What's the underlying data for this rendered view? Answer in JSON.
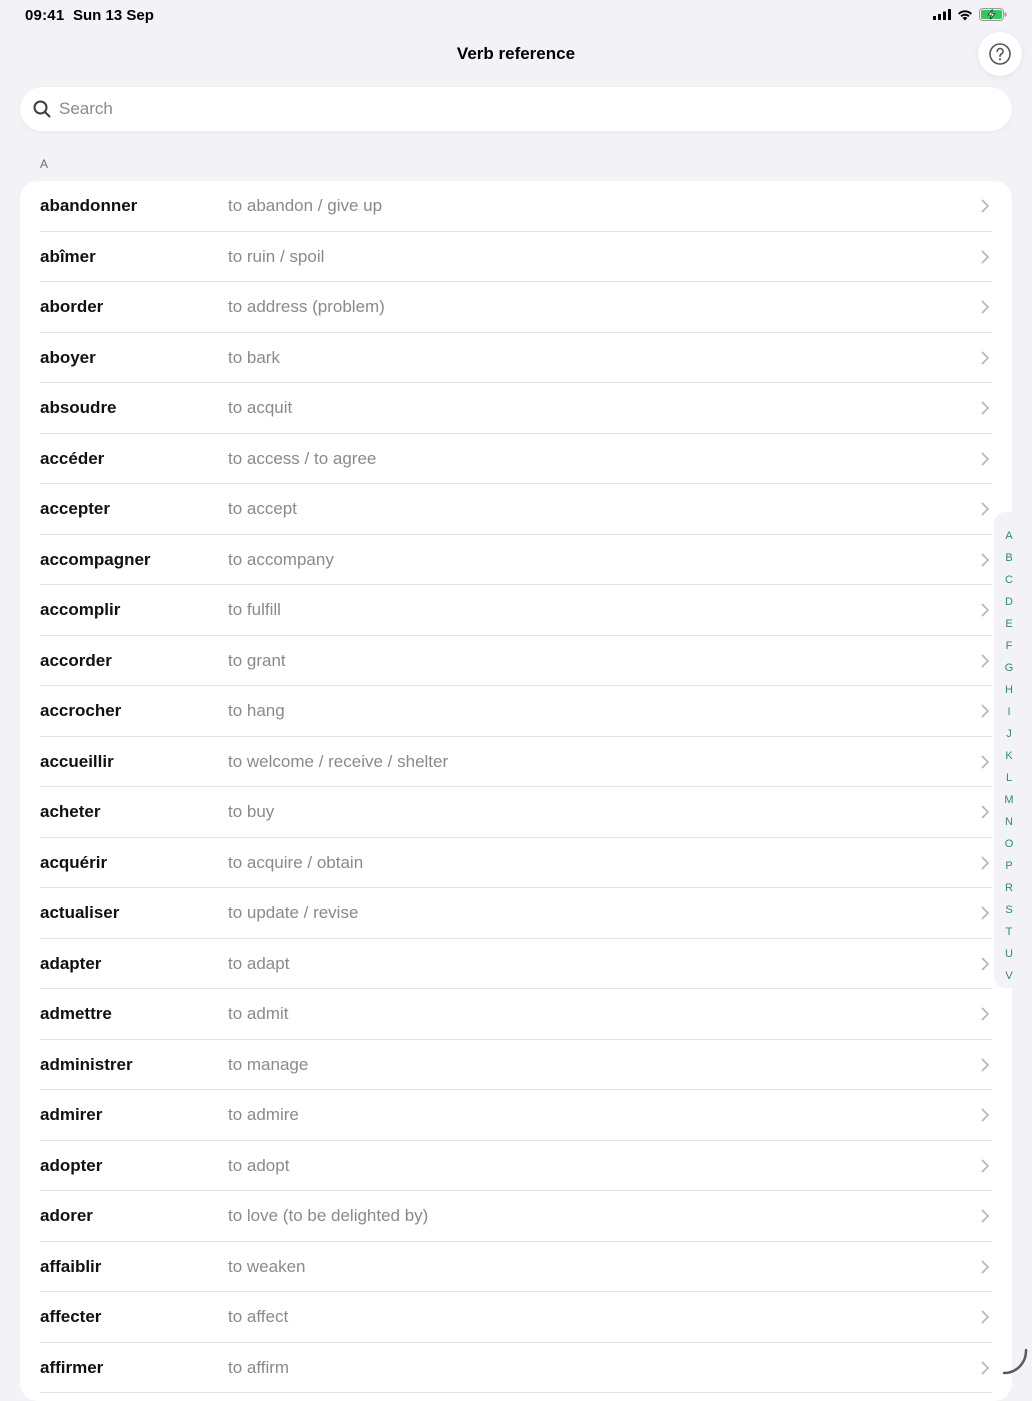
{
  "status": {
    "time": "09:41",
    "date": "Sun 13 Sep",
    "icons": [
      "cellular-signal-icon",
      "wifi-icon",
      "battery-charging-icon"
    ]
  },
  "nav": {
    "title": "Verb reference",
    "help_icon": "question-circle-icon"
  },
  "search": {
    "placeholder": "Search"
  },
  "section": {
    "header": "A"
  },
  "verbs": [
    {
      "verb": "abandonner",
      "meaning": "to abandon / give up"
    },
    {
      "verb": "abîmer",
      "meaning": "to ruin / spoil"
    },
    {
      "verb": "aborder",
      "meaning": "to address (problem)"
    },
    {
      "verb": "aboyer",
      "meaning": "to bark"
    },
    {
      "verb": "absoudre",
      "meaning": "to acquit"
    },
    {
      "verb": "accéder",
      "meaning": "to access / to agree"
    },
    {
      "verb": "accepter",
      "meaning": "to accept"
    },
    {
      "verb": "accompagner",
      "meaning": "to accompany"
    },
    {
      "verb": "accomplir",
      "meaning": "to fulfill"
    },
    {
      "verb": "accorder",
      "meaning": "to grant"
    },
    {
      "verb": "accrocher",
      "meaning": "to hang"
    },
    {
      "verb": "accueillir",
      "meaning": "to welcome / receive / shelter"
    },
    {
      "verb": "acheter",
      "meaning": "to buy"
    },
    {
      "verb": "acquérir",
      "meaning": "to acquire / obtain"
    },
    {
      "verb": "actualiser",
      "meaning": "to update / revise"
    },
    {
      "verb": "adapter",
      "meaning": "to adapt"
    },
    {
      "verb": "admettre",
      "meaning": "to admit"
    },
    {
      "verb": "administrer",
      "meaning": "to manage"
    },
    {
      "verb": "admirer",
      "meaning": "to admire"
    },
    {
      "verb": "adopter",
      "meaning": "to adopt"
    },
    {
      "verb": "adorer",
      "meaning": "to love (to be delighted by)"
    },
    {
      "verb": "affaiblir",
      "meaning": "to weaken"
    },
    {
      "verb": "affecter",
      "meaning": "to affect"
    },
    {
      "verb": "affirmer",
      "meaning": "to affirm"
    }
  ],
  "index_letters": [
    "A",
    "B",
    "C",
    "D",
    "E",
    "F",
    "G",
    "H",
    "I",
    "J",
    "K",
    "L",
    "M",
    "N",
    "O",
    "P",
    "R",
    "S",
    "T",
    "U",
    "V"
  ],
  "colors": {
    "background": "#f2f2f7",
    "accent": "#2e8b6f",
    "secondary_text": "#8a8a8e",
    "battery": "#34c759"
  }
}
